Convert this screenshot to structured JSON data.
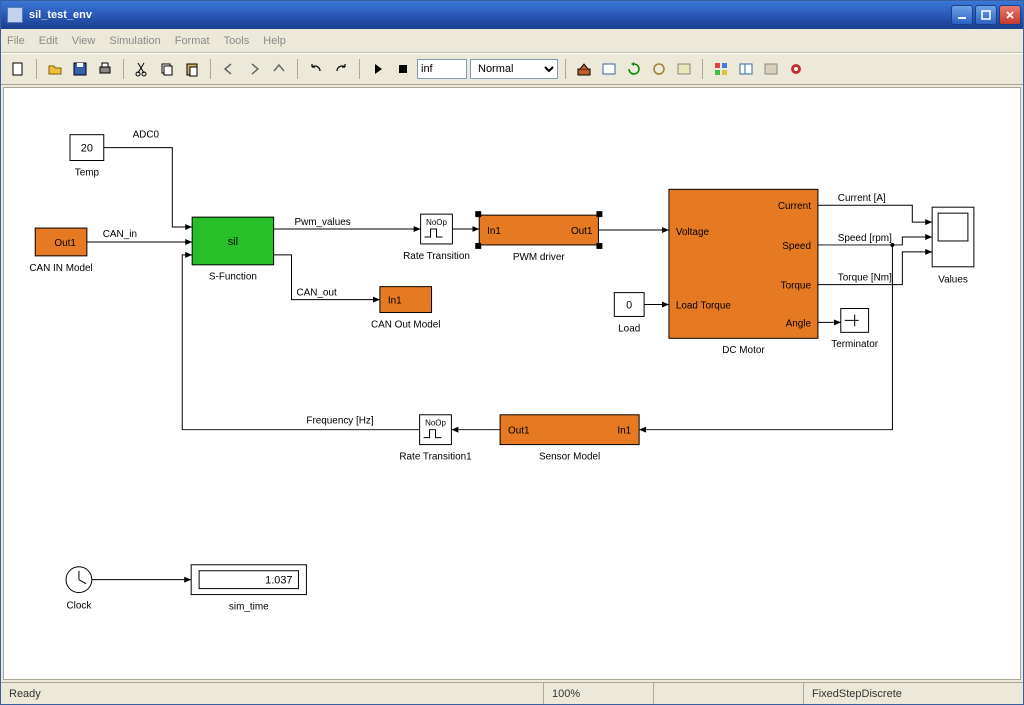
{
  "window": {
    "title": "sil_test_env"
  },
  "menus": [
    "File",
    "Edit",
    "View",
    "Simulation",
    "Format",
    "Tools",
    "Help"
  ],
  "toolbar": {
    "stop_time": "inf",
    "mode": "Normal"
  },
  "status": {
    "ready": "Ready",
    "zoom": "100%",
    "solver": "FixedStepDiscrete"
  },
  "blocks": {
    "temp": {
      "txt": "20",
      "label": "Temp"
    },
    "adc0": "ADC0",
    "canin": {
      "port": "Out1",
      "label": "CAN IN Model",
      "signal": "CAN_in"
    },
    "sfunc": {
      "txt": "sil",
      "label": "S-Function"
    },
    "pwd": "Pwm_values",
    "rt": {
      "txt": "NoOp",
      "label": "Rate Transition"
    },
    "pwm": {
      "in": "In1",
      "out": "Out1",
      "label": "PWM driver"
    },
    "canout": {
      "signal": "CAN_out",
      "port": "In1",
      "label": "CAN Out Model"
    },
    "load": {
      "txt": "0",
      "label": "Load"
    },
    "dcmotor": {
      "in1": "Voltage",
      "in2": "Load Torque",
      "out1": "Current",
      "out2": "Speed",
      "out3": "Torque",
      "out4": "Angle",
      "label": "DC Motor"
    },
    "signals": {
      "current": "Current [A]",
      "speed": "Speed [rpm]",
      "torque": "Torque [Nm]"
    },
    "scope": {
      "label": "Values"
    },
    "term": {
      "label": "Terminator"
    },
    "freq": "Frequency [Hz]",
    "rt1": {
      "txt": "NoOp",
      "label": "Rate Transition1"
    },
    "sensor": {
      "in": "In1",
      "out": "Out1",
      "label": "Sensor Model"
    },
    "clock": {
      "label": "Clock"
    },
    "simtime": {
      "val": "1.037",
      "label": "sim_time"
    }
  }
}
